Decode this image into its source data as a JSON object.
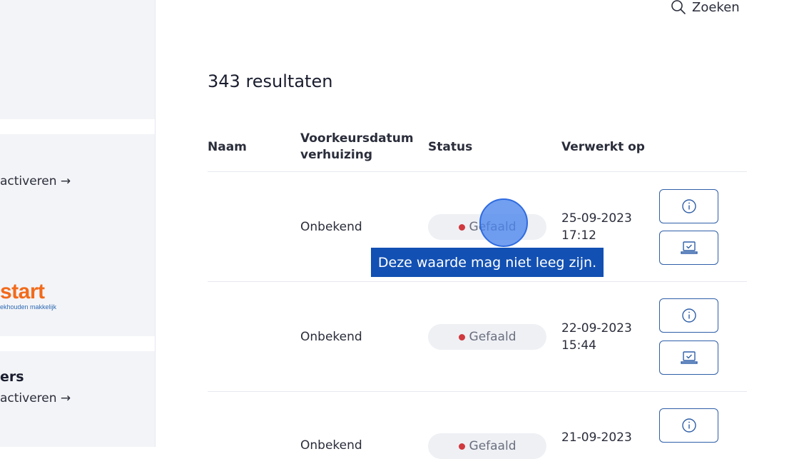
{
  "sidebar": {
    "link1": "activeren →",
    "logo_text": "start",
    "logo_sub": "ekhouden makkelijk",
    "title": "ers",
    "link2": "activeren →"
  },
  "search": {
    "label": "Zoeken",
    "icon": "search-icon"
  },
  "results_label": "343 resultaten",
  "columns": {
    "naam": "Naam",
    "voorkeur_l1": "Voorkeursdatum",
    "voorkeur_l2": "verhuizing",
    "status": "Status",
    "verwerkt": "Verwerkt op"
  },
  "rows": [
    {
      "naam": "",
      "voorkeursdatum": "Onbekend",
      "status": "Gefaald",
      "datum": "25-09-2023",
      "tijd": "17:12"
    },
    {
      "naam": "",
      "voorkeursdatum": "Onbekend",
      "status": "Gefaald",
      "datum": "22-09-2023",
      "tijd": "15:44"
    },
    {
      "naam": "",
      "voorkeursdatum": "Onbekend",
      "status": "Gefaald",
      "datum": "21-09-2023",
      "tijd": ""
    }
  ],
  "tooltip": "Deze waarde mag niet leeg zijn.",
  "colors": {
    "accent": "#2f5fa8",
    "status_failed": "#d0393e",
    "tooltip_bg": "#1250b3"
  }
}
